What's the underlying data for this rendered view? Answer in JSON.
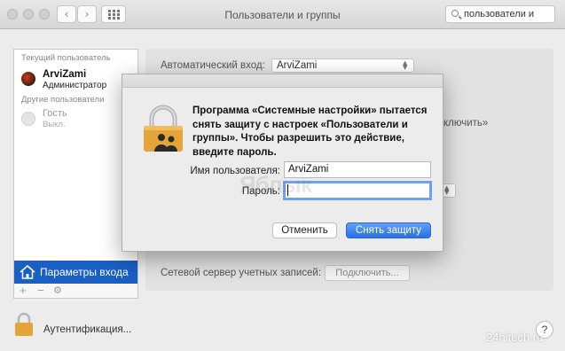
{
  "window": {
    "title": "Пользователи и группы"
  },
  "search": {
    "value": "пользователи и"
  },
  "sidebar": {
    "current_header": "Текущий пользователь",
    "current_user": {
      "name": "ArviZami",
      "role": "Администратор"
    },
    "others_header": "Другие пользователи",
    "guest": {
      "name": "Гость",
      "status": "Выкл."
    },
    "selected_item": "Параметры входа",
    "add_label": "+",
    "remove_label": "−"
  },
  "panel": {
    "autologin_label": "Автоматический вход:",
    "autologin_value": "ArviZami",
    "partial_button": "ключить»",
    "network_label": "Сетевой сервер учетных записей:",
    "connect_button": "Подключить..."
  },
  "dialog": {
    "message": "Программа «Системные настройки» пытается снять защиту с настроек «Пользователи и группы». Чтобы разрешить это действие, введите пароль.",
    "username_label": "Имя пользователя:",
    "username_value": "ArviZami",
    "password_label": "Пароль:",
    "password_value": "",
    "cancel_label": "Отменить",
    "unlock_label": "Снять защиту"
  },
  "footer": {
    "auth_label": "Аутентификация...",
    "help_label": "?",
    "watermark": "24hitech.ru"
  },
  "watermark_center": "Яблык",
  "colors": {
    "selection": "#1a5fc4",
    "accent": "#2a6fe6",
    "lock": "#e3a43a"
  }
}
